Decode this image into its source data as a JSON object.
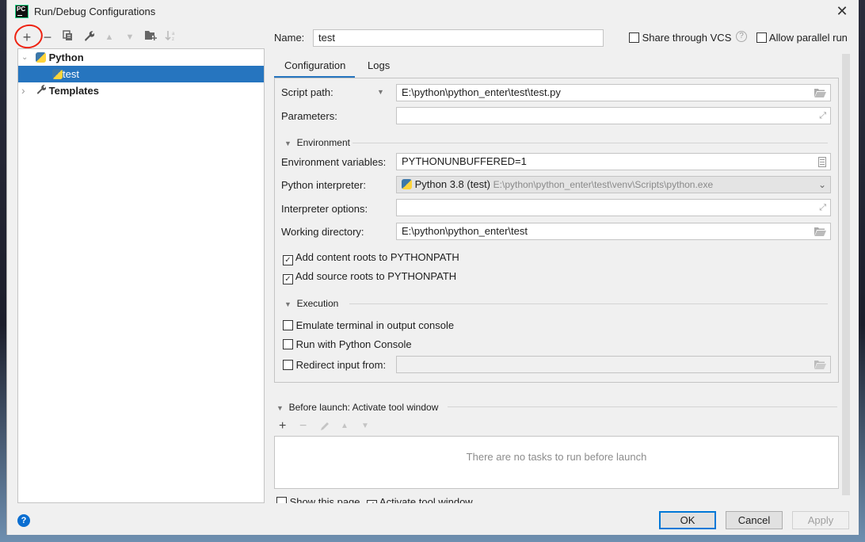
{
  "window": {
    "title": "Run/Debug Configurations",
    "app_icon_text": "PC",
    "close_glyph": "✕"
  },
  "toolbar": {
    "icons": [
      {
        "name": "add-icon",
        "glyph": "+",
        "enabled": true
      },
      {
        "name": "remove-icon",
        "glyph": "−",
        "enabled": true
      },
      {
        "name": "copy-icon",
        "glyph": "❐",
        "enabled": true
      },
      {
        "name": "wrench-icon",
        "glyph": "🔧",
        "enabled": true
      },
      {
        "name": "move-up-icon",
        "glyph": "▲",
        "enabled": false
      },
      {
        "name": "move-down-icon",
        "glyph": "▼",
        "enabled": false
      },
      {
        "name": "new-folder-icon",
        "glyph": "📁",
        "enabled": true
      },
      {
        "name": "sort-icon",
        "glyph": "⇃ᵃᶻ",
        "enabled": false
      }
    ]
  },
  "tree": {
    "items": [
      {
        "label": "Python",
        "expanded": true,
        "bold": true,
        "arrow": "⌄"
      },
      {
        "label": "test",
        "selected": true
      },
      {
        "label": "Templates",
        "expanded": false,
        "bold": true,
        "arrow": "›"
      }
    ]
  },
  "header": {
    "name_label": "Name:",
    "name_value": "test",
    "share_vcs_label": "Share through VCS",
    "share_vcs_checked": false,
    "help_glyph": "?",
    "allow_parallel_label": "Allow parallel run",
    "allow_parallel_checked": false
  },
  "tabs": [
    {
      "label": "Configuration",
      "active": true
    },
    {
      "label": "Logs",
      "active": false
    }
  ],
  "config": {
    "script_path_label": "Script path:",
    "script_path_value": "E:\\python\\python_enter\\test\\test.py",
    "parameters_label": "Parameters:",
    "parameters_value": "",
    "environment_section": "Environment",
    "env_vars_label": "Environment variables:",
    "env_vars_value": "PYTHONUNBUFFERED=1",
    "interpreter_label": "Python interpreter:",
    "interpreter_name": "Python 3.8 (test)",
    "interpreter_path": "E:\\python\\python_enter\\test\\venv\\Scripts\\python.exe",
    "interp_options_label": "Interpreter options:",
    "interp_options_value": "",
    "working_dir_label": "Working directory:",
    "working_dir_value": "E:\\python\\python_enter\\test",
    "add_content_roots_label": "Add content roots to PYTHONPATH",
    "add_content_roots_checked": true,
    "add_source_roots_label": "Add source roots to PYTHONPATH",
    "add_source_roots_checked": true,
    "execution_section": "Execution",
    "emulate_terminal_label": "Emulate terminal in output console",
    "emulate_terminal_checked": false,
    "run_console_label": "Run with Python Console",
    "run_console_checked": false,
    "redirect_input_label": "Redirect input from:",
    "redirect_input_checked": false,
    "redirect_input_value": ""
  },
  "before_launch": {
    "title": "Before launch: Activate tool window",
    "empty_text": "There are no tasks to run before launch",
    "show_page_label": "Show this page",
    "show_page_checked": false,
    "activate_tool_label": "Activate tool window",
    "activate_tool_checked": true
  },
  "buttons": {
    "ok": "OK",
    "cancel": "Cancel",
    "apply": "Apply"
  },
  "help_glyph": "?",
  "colors": {
    "accent": "#2675bf",
    "focus": "#0078d7",
    "annotation": "#e21a1a"
  }
}
